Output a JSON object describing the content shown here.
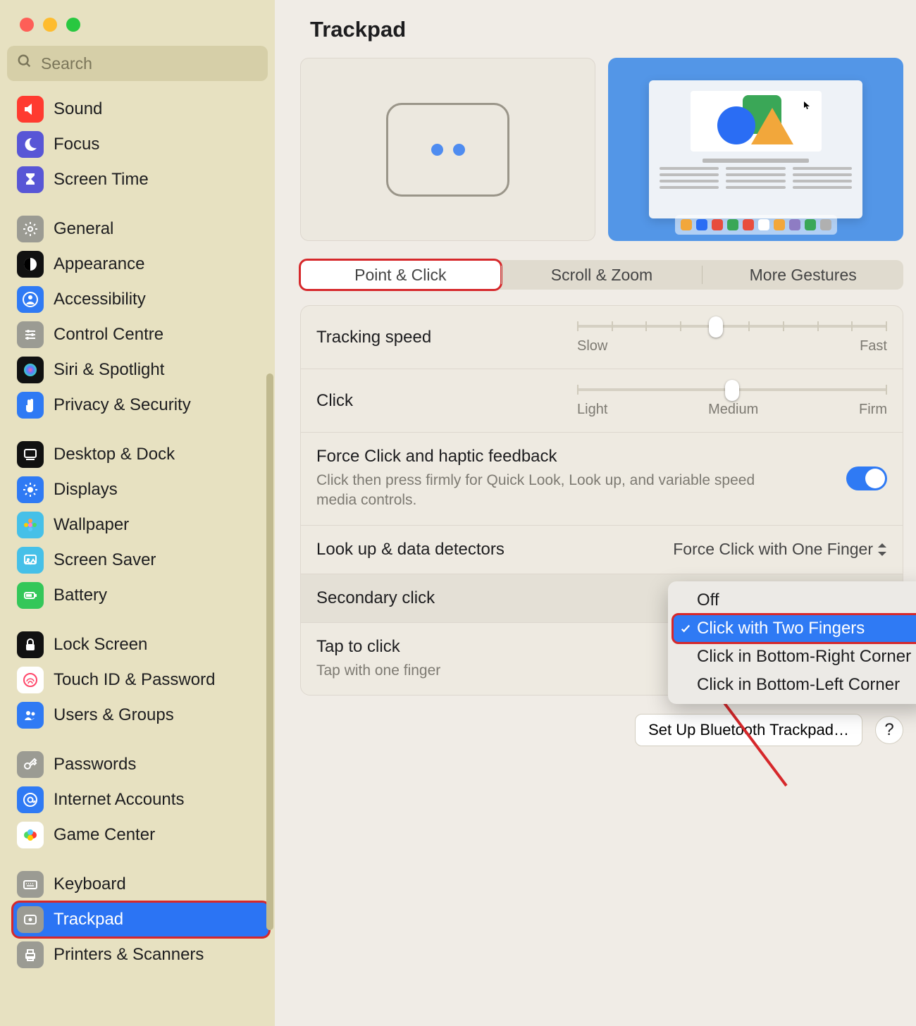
{
  "search_placeholder": "Search",
  "title": "Trackpad",
  "sidebar_groups": [
    [
      {
        "label": "Sound",
        "ic_bg": "#ff3b30",
        "glyph": "speaker"
      },
      {
        "label": "Focus",
        "ic_bg": "#5856d6",
        "glyph": "moon"
      },
      {
        "label": "Screen Time",
        "ic_bg": "#5856d6",
        "glyph": "hourglass"
      }
    ],
    [
      {
        "label": "General",
        "ic_bg": "#9b9b93",
        "glyph": "gear"
      },
      {
        "label": "Appearance",
        "ic_bg": "#111",
        "glyph": "contrast"
      },
      {
        "label": "Accessibility",
        "ic_bg": "#2f7af4",
        "glyph": "person"
      },
      {
        "label": "Control Centre",
        "ic_bg": "#9b9b93",
        "glyph": "sliders"
      },
      {
        "label": "Siri & Spotlight",
        "ic_bg": "#111",
        "glyph": "siri"
      },
      {
        "label": "Privacy & Security",
        "ic_bg": "#2f7af4",
        "glyph": "hand"
      }
    ],
    [
      {
        "label": "Desktop & Dock",
        "ic_bg": "#111",
        "glyph": "dock"
      },
      {
        "label": "Displays",
        "ic_bg": "#2f7af4",
        "glyph": "sun"
      },
      {
        "label": "Wallpaper",
        "ic_bg": "#46c0e8",
        "glyph": "flower"
      },
      {
        "label": "Screen Saver",
        "ic_bg": "#46c0e8",
        "glyph": "ssaver"
      },
      {
        "label": "Battery",
        "ic_bg": "#34c759",
        "glyph": "battery"
      }
    ],
    [
      {
        "label": "Lock Screen",
        "ic_bg": "#111",
        "glyph": "lock"
      },
      {
        "label": "Touch ID & Password",
        "ic_bg": "#fff",
        "glyph": "touchid"
      },
      {
        "label": "Users & Groups",
        "ic_bg": "#2f7af4",
        "glyph": "people"
      }
    ],
    [
      {
        "label": "Passwords",
        "ic_bg": "#9b9b93",
        "glyph": "key"
      },
      {
        "label": "Internet Accounts",
        "ic_bg": "#2f7af4",
        "glyph": "at"
      },
      {
        "label": "Game Center",
        "ic_bg": "#fff",
        "glyph": "game"
      }
    ],
    [
      {
        "label": "Keyboard",
        "ic_bg": "#9b9b93",
        "glyph": "keyboard"
      },
      {
        "label": "Trackpad",
        "ic_bg": "#9b9b93",
        "glyph": "trackpad",
        "selected": true,
        "highlighted": true
      },
      {
        "label": "Printers & Scanners",
        "ic_bg": "#9b9b93",
        "glyph": "printer"
      }
    ]
  ],
  "tabs": [
    "Point & Click",
    "Scroll & Zoom",
    "More Gestures"
  ],
  "tracking": {
    "label": "Tracking speed",
    "min_label": "Slow",
    "max_label": "Fast",
    "ticks": 10,
    "value_index": 4
  },
  "click": {
    "label": "Click",
    "labels": [
      "Light",
      "Medium",
      "Firm"
    ],
    "ticks": 3,
    "value_index": 1
  },
  "force": {
    "label": "Force Click and haptic feedback",
    "desc": "Click then press firmly for Quick Look, Look up, and variable speed media controls.",
    "on": true
  },
  "lookup": {
    "label": "Look up & data detectors",
    "value": "Force Click with One Finger"
  },
  "secondary": {
    "label": "Secondary click",
    "value": "Click with Two Fingers",
    "options": [
      "Off",
      "Click with Two Fingers",
      "Click in Bottom-Right Corner",
      "Click in Bottom-Left Corner"
    ],
    "selected_index": 1
  },
  "tap": {
    "label": "Tap to click",
    "desc": "Tap with one finger"
  },
  "bluetooth_btn": "Set Up Bluetooth Trackpad…",
  "help": "?",
  "dock_colors": [
    "#f2a73b",
    "#2a6df4",
    "#e84d3d",
    "#3aa757",
    "#e84d3d",
    "#ffffff",
    "#f2a73b",
    "#8e7cc3",
    "#3aa757",
    "#b0b0b0"
  ]
}
